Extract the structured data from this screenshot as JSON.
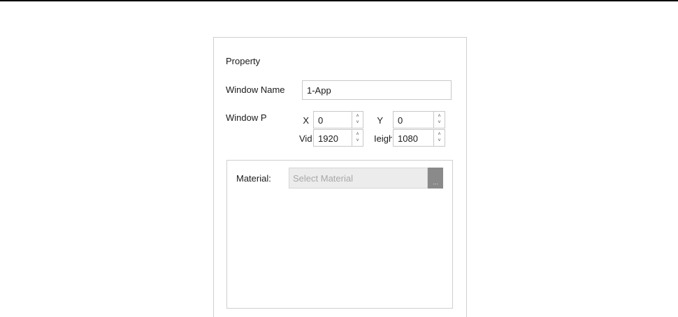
{
  "panel": {
    "title": "Property",
    "window_name_label": "Window Name",
    "window_name_value": "1-App",
    "window_pos_label": "Window P",
    "x_label": "X",
    "x_value": "0",
    "y_label": "Y",
    "y_value": "0",
    "width_label": "Vidtl",
    "width_value": "1920",
    "height_label": "Ieigh",
    "height_value": "1080",
    "spin_up_glyph": "˄",
    "spin_down_glyph": "˅"
  },
  "material": {
    "label": "Material:",
    "placeholder": "Select Material",
    "browse_label": "..."
  },
  "icons": {
    "spin_up": "chevron-up-icon",
    "spin_down": "chevron-down-icon"
  },
  "colors": {
    "border": "#cfcfcf",
    "browse_button": "#8a8a8a",
    "select_background": "#ececec",
    "placeholder_text": "#a8a8a8"
  }
}
